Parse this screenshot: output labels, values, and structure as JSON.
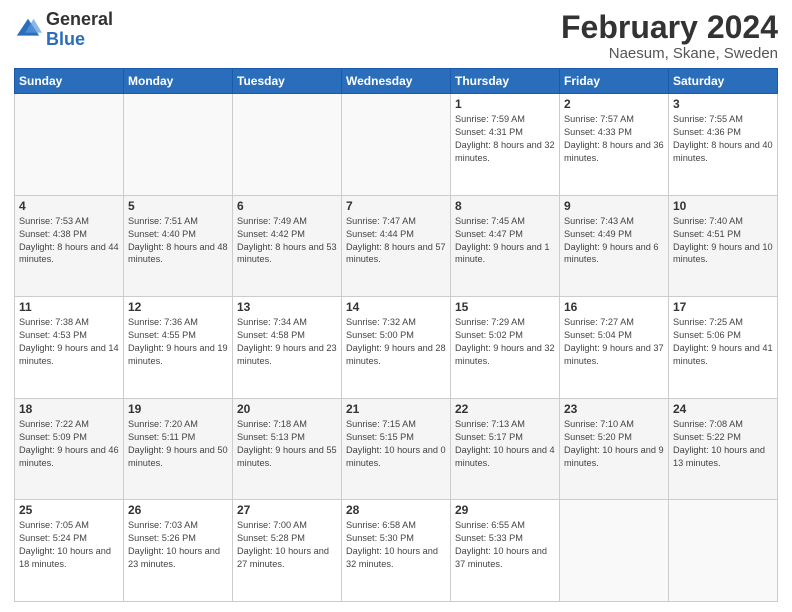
{
  "logo": {
    "general": "General",
    "blue": "Blue"
  },
  "header": {
    "title": "February 2024",
    "subtitle": "Naesum, Skane, Sweden"
  },
  "weekdays": [
    "Sunday",
    "Monday",
    "Tuesday",
    "Wednesday",
    "Thursday",
    "Friday",
    "Saturday"
  ],
  "weeks": [
    [
      {
        "day": "",
        "info": ""
      },
      {
        "day": "",
        "info": ""
      },
      {
        "day": "",
        "info": ""
      },
      {
        "day": "",
        "info": ""
      },
      {
        "day": "1",
        "info": "Sunrise: 7:59 AM\nSunset: 4:31 PM\nDaylight: 8 hours and 32 minutes."
      },
      {
        "day": "2",
        "info": "Sunrise: 7:57 AM\nSunset: 4:33 PM\nDaylight: 8 hours and 36 minutes."
      },
      {
        "day": "3",
        "info": "Sunrise: 7:55 AM\nSunset: 4:36 PM\nDaylight: 8 hours and 40 minutes."
      }
    ],
    [
      {
        "day": "4",
        "info": "Sunrise: 7:53 AM\nSunset: 4:38 PM\nDaylight: 8 hours and 44 minutes."
      },
      {
        "day": "5",
        "info": "Sunrise: 7:51 AM\nSunset: 4:40 PM\nDaylight: 8 hours and 48 minutes."
      },
      {
        "day": "6",
        "info": "Sunrise: 7:49 AM\nSunset: 4:42 PM\nDaylight: 8 hours and 53 minutes."
      },
      {
        "day": "7",
        "info": "Sunrise: 7:47 AM\nSunset: 4:44 PM\nDaylight: 8 hours and 57 minutes."
      },
      {
        "day": "8",
        "info": "Sunrise: 7:45 AM\nSunset: 4:47 PM\nDaylight: 9 hours and 1 minute."
      },
      {
        "day": "9",
        "info": "Sunrise: 7:43 AM\nSunset: 4:49 PM\nDaylight: 9 hours and 6 minutes."
      },
      {
        "day": "10",
        "info": "Sunrise: 7:40 AM\nSunset: 4:51 PM\nDaylight: 9 hours and 10 minutes."
      }
    ],
    [
      {
        "day": "11",
        "info": "Sunrise: 7:38 AM\nSunset: 4:53 PM\nDaylight: 9 hours and 14 minutes."
      },
      {
        "day": "12",
        "info": "Sunrise: 7:36 AM\nSunset: 4:55 PM\nDaylight: 9 hours and 19 minutes."
      },
      {
        "day": "13",
        "info": "Sunrise: 7:34 AM\nSunset: 4:58 PM\nDaylight: 9 hours and 23 minutes."
      },
      {
        "day": "14",
        "info": "Sunrise: 7:32 AM\nSunset: 5:00 PM\nDaylight: 9 hours and 28 minutes."
      },
      {
        "day": "15",
        "info": "Sunrise: 7:29 AM\nSunset: 5:02 PM\nDaylight: 9 hours and 32 minutes."
      },
      {
        "day": "16",
        "info": "Sunrise: 7:27 AM\nSunset: 5:04 PM\nDaylight: 9 hours and 37 minutes."
      },
      {
        "day": "17",
        "info": "Sunrise: 7:25 AM\nSunset: 5:06 PM\nDaylight: 9 hours and 41 minutes."
      }
    ],
    [
      {
        "day": "18",
        "info": "Sunrise: 7:22 AM\nSunset: 5:09 PM\nDaylight: 9 hours and 46 minutes."
      },
      {
        "day": "19",
        "info": "Sunrise: 7:20 AM\nSunset: 5:11 PM\nDaylight: 9 hours and 50 minutes."
      },
      {
        "day": "20",
        "info": "Sunrise: 7:18 AM\nSunset: 5:13 PM\nDaylight: 9 hours and 55 minutes."
      },
      {
        "day": "21",
        "info": "Sunrise: 7:15 AM\nSunset: 5:15 PM\nDaylight: 10 hours and 0 minutes."
      },
      {
        "day": "22",
        "info": "Sunrise: 7:13 AM\nSunset: 5:17 PM\nDaylight: 10 hours and 4 minutes."
      },
      {
        "day": "23",
        "info": "Sunrise: 7:10 AM\nSunset: 5:20 PM\nDaylight: 10 hours and 9 minutes."
      },
      {
        "day": "24",
        "info": "Sunrise: 7:08 AM\nSunset: 5:22 PM\nDaylight: 10 hours and 13 minutes."
      }
    ],
    [
      {
        "day": "25",
        "info": "Sunrise: 7:05 AM\nSunset: 5:24 PM\nDaylight: 10 hours and 18 minutes."
      },
      {
        "day": "26",
        "info": "Sunrise: 7:03 AM\nSunset: 5:26 PM\nDaylight: 10 hours and 23 minutes."
      },
      {
        "day": "27",
        "info": "Sunrise: 7:00 AM\nSunset: 5:28 PM\nDaylight: 10 hours and 27 minutes."
      },
      {
        "day": "28",
        "info": "Sunrise: 6:58 AM\nSunset: 5:30 PM\nDaylight: 10 hours and 32 minutes."
      },
      {
        "day": "29",
        "info": "Sunrise: 6:55 AM\nSunset: 5:33 PM\nDaylight: 10 hours and 37 minutes."
      },
      {
        "day": "",
        "info": ""
      },
      {
        "day": "",
        "info": ""
      }
    ]
  ]
}
